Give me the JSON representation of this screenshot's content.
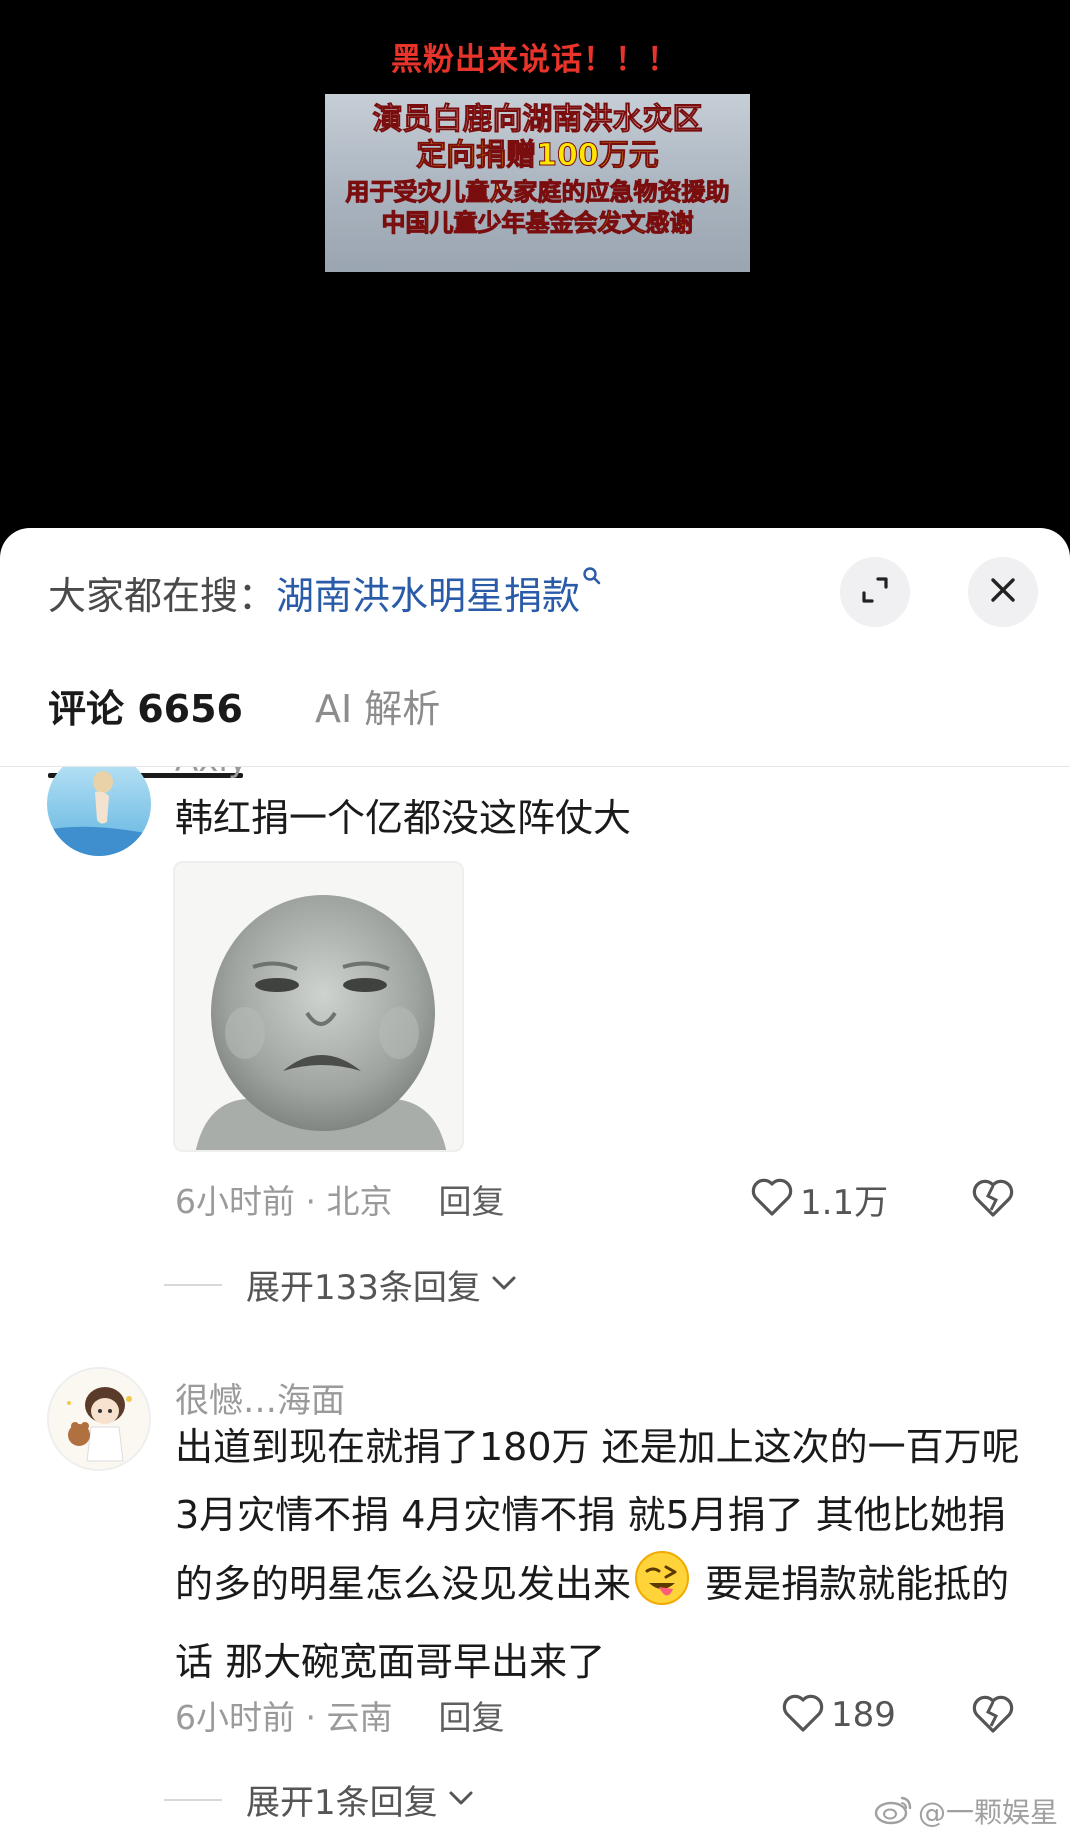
{
  "video": {
    "headline": "黑粉出来说话！！！",
    "news_lines": [
      "演员白鹿向湖南洪水灾区",
      "定向捐赠100万元",
      "用于受灾儿童及家庭的应急物资援助",
      "中国儿童少年基金会发文感谢"
    ]
  },
  "search": {
    "prefix": "大家都在搜：",
    "term": "湖南洪水明星捐款"
  },
  "tabs": [
    {
      "label": "评论 6656",
      "active": true
    },
    {
      "label": "AI 解析",
      "active": false
    }
  ],
  "comments": [
    {
      "username": "Axiy",
      "text": "韩红捐一个亿都没这阵仗大",
      "has_sticker": true,
      "time_location": "6小时前 · 北京",
      "reply_label": "回复",
      "likes": "1.1万",
      "expand_label": "展开133条回复"
    },
    {
      "username": "很憾…海面",
      "text_before_emoji": "出道到现在就捐了180万 还是加上这次的一百万呢 3月灾情不捐 4月灾情不捐 就5月捐了 其他比她捐的多的明星怎么没见发出来",
      "text_after_emoji": " 要是捐款就能抵的话 那大碗宽面哥早出来了",
      "time_location": "6小时前 · 云南",
      "reply_label": "回复",
      "likes": "189",
      "expand_label": "展开1条回复"
    }
  ],
  "watermark": "@一颗娱星"
}
